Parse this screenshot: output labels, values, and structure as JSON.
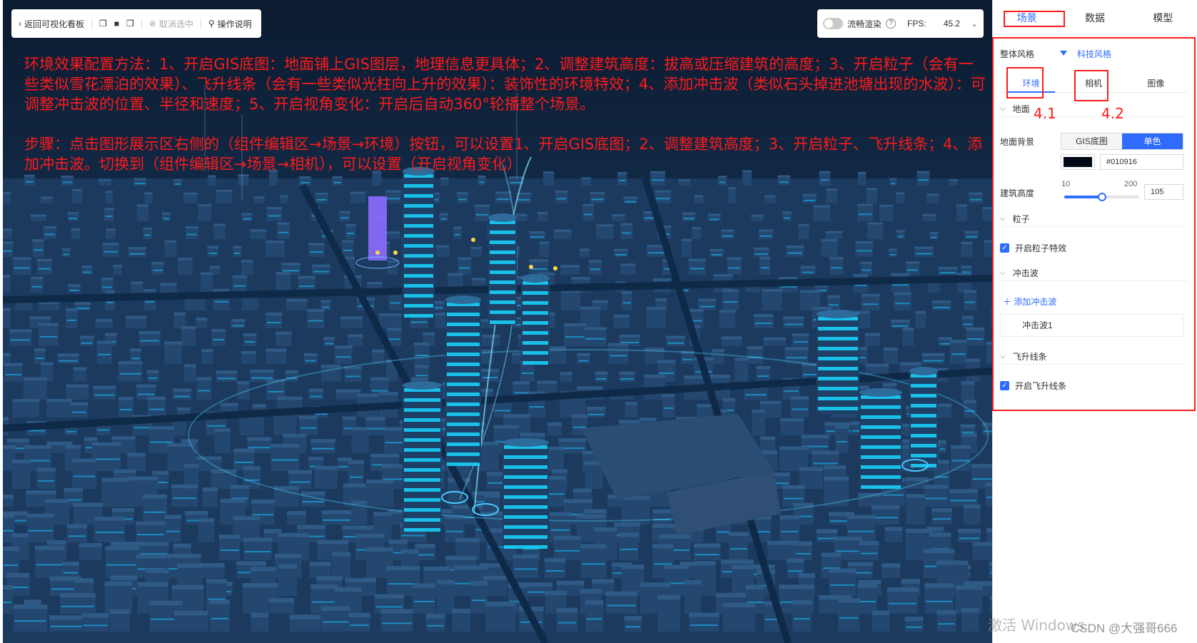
{
  "toolbar": {
    "back_label": "返回可视化看板",
    "cancel_select_label": "取消选中",
    "help_label": "操作说明"
  },
  "render_bar": {
    "smooth_label": "流畅渲染",
    "fps_label": "FPS:",
    "fps_value": "45.2"
  },
  "annotation": {
    "paragraph1": "环境效果配置方法：1、开启GIS底图：地面铺上GIS图层，地理信息更具体；2、调整建筑高度：拔高或压缩建筑的高度；3、开启粒子（会有一些类似雪花漂泊的效果）、飞升线条（会有一些类似光柱向上升的效果）：装饰性的环境特效；4、添加冲击波（类似石头掉进池塘出现的水波）：可调整冲击波的位置、半径和速度；5、开启视角变化：开启后自动360°轮播整个场景。",
    "paragraph2": "步骤：点击图形展示区右侧的（组件编辑区→场景→环境）按钮，可以设置1、开启GIS底图；2、调整建筑高度；3、开启粒子、飞升线条；4、添加冲击波。切换到（组件编辑区→场景→相机），可以设置（开启视角变化）",
    "label_41": "4.1",
    "label_42": "4.2"
  },
  "panel": {
    "tabs": [
      "场景",
      "数据",
      "模型"
    ],
    "active_tab": "场景",
    "overall_style_label": "整体风格",
    "overall_style_value": "科技风格",
    "sub_tabs": [
      "环境",
      "相机",
      "图像"
    ],
    "active_sub_tab": "环境",
    "ground": {
      "title": "地面",
      "bg_label": "地面背景",
      "bg_options": [
        "GIS底图",
        "单色"
      ],
      "bg_selected": "单色",
      "color": "#010916",
      "color_text": "#010916",
      "height_label": "建筑高度",
      "height_min": "10",
      "height_max": "200",
      "height_value": "105",
      "height_level": 0.5
    },
    "particles": {
      "title": "粒子",
      "enable_label": "开启粒子特效",
      "enabled": true
    },
    "shockwave": {
      "title": "冲击波",
      "add_label": "添加冲击波",
      "items": [
        "冲击波1"
      ]
    },
    "flylines": {
      "title": "飞升线条",
      "enable_label": "开启飞升线条",
      "enabled": true
    }
  },
  "watermark": {
    "activate_text": "激活 Windows",
    "csdn_text": "CSDN @大强哥666"
  },
  "colors": {
    "accent": "#2f6bff",
    "annotation_red": "#ff1a1a",
    "scene_dark": "#0b1b30",
    "building_glow": "#19d7ff"
  }
}
